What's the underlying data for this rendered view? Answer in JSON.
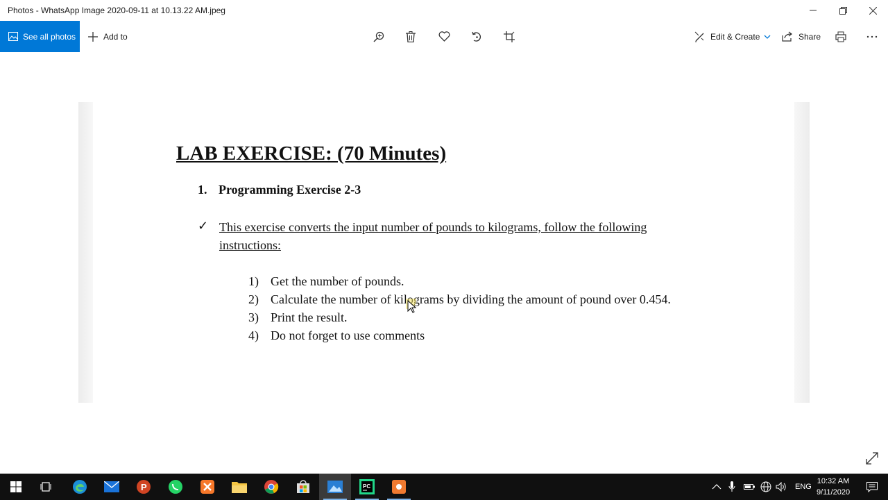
{
  "window": {
    "title": "Photos - WhatsApp Image 2020-09-11 at 10.13.22 AM.jpeg"
  },
  "toolbar": {
    "see_all_photos": "See all photos",
    "add_to": "Add to",
    "edit_create": "Edit & Create",
    "share": "Share",
    "icons": [
      "zoom-icon",
      "delete-icon",
      "favorite-icon",
      "rotate-icon",
      "crop-icon",
      "print-icon",
      "more-icon"
    ]
  },
  "document": {
    "heading": "LAB EXERCISE: (70 Minutes)",
    "section_number": "1.",
    "section_title": "Programming Exercise 2-3",
    "check_mark": "✓",
    "intro": "This exercise converts the input number of pounds to kilograms, follow the following instructions:",
    "steps": [
      {
        "n": "1)",
        "text": "Get the number of pounds."
      },
      {
        "n": "2)",
        "text": "Calculate the number of kilograms by dividing the amount of pound over 0.454."
      },
      {
        "n": "3)",
        "text": "Print the result."
      },
      {
        "n": "4)",
        "text": "Do not forget to use comments"
      }
    ]
  },
  "taskbar": {
    "apps": [
      "start",
      "task-view",
      "edge",
      "mail",
      "powerpoint",
      "whatsapp",
      "xampp",
      "file-explorer",
      "chrome",
      "store",
      "photos",
      "pycharm",
      "recorder"
    ],
    "language": "ENG",
    "time": "10:32 AM",
    "date": "9/11/2020"
  },
  "colors": {
    "accent": "#0078d7",
    "taskbar": "#101010"
  }
}
